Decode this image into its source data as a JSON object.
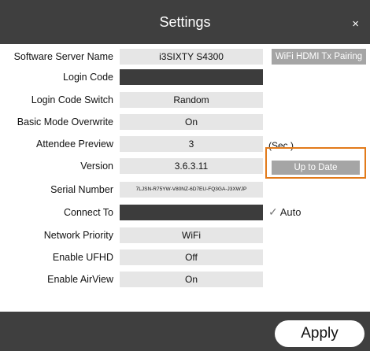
{
  "dialog": {
    "title": "Settings",
    "close_icon": "×"
  },
  "rows": [
    {
      "label": "Software Server Name",
      "value": "i3SIXTY S4300",
      "button": "WiFi HDMI Tx Pairing"
    },
    {
      "label": "Login Code",
      "value": ""
    },
    {
      "label": "Login Code Switch",
      "value": "Random"
    },
    {
      "label": "Basic Mode Overwrite",
      "value": "On"
    },
    {
      "label": "Attendee Preview",
      "value": "3",
      "suffix": "(Sec.)"
    },
    {
      "label": "Version",
      "value": "3.6.3.11",
      "button": "Up to Date"
    },
    {
      "label": "Serial Number",
      "value": "7LJSN-R75YW-V80NZ-6D7EU-FQ3GA-J3XWJP"
    },
    {
      "label": "Connect To",
      "value": "",
      "checkbox_label": "Auto",
      "checkbox_checked": true
    },
    {
      "label": "Network Priority",
      "value": "WiFi"
    },
    {
      "label": "Enable UFHD",
      "value": "Off"
    },
    {
      "label": "Enable AirView",
      "value": "On"
    }
  ],
  "footer": {
    "apply_label": "Apply"
  },
  "colors": {
    "titlebar": "#3f3f3f",
    "field": "#e6e6e6",
    "dark_field": "#3c3c3c",
    "button_gray": "#a5a5a5",
    "highlight_orange": "#e27a1a"
  }
}
